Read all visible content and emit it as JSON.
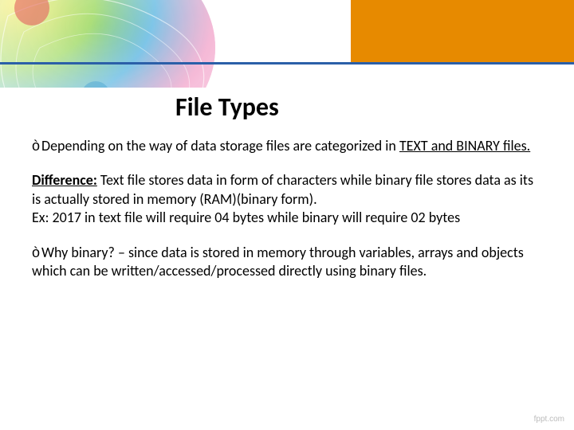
{
  "header": {
    "accent_color": "#e78a00",
    "line_color": "#2b5fa8"
  },
  "title": "File Types",
  "bullet_arrow": "ò",
  "p1_a": "Depending on the way of data storage files are categorized in ",
  "p1_b": "TEXT and BINARY files.",
  "p2_a": "Difference:",
  "p2_b": " Text file stores data in form of characters while binary file stores data as its is actually stored in memory (RAM)(binary form).",
  "p2_c": "Ex: 2017 in text file will require 04 bytes while binary will require 02 bytes",
  "p3_a": "Why binary? – since data is stored in memory through variables, arrays and objects which can be written/accessed/processed directly using binary files.",
  "watermark": "fppt.com"
}
